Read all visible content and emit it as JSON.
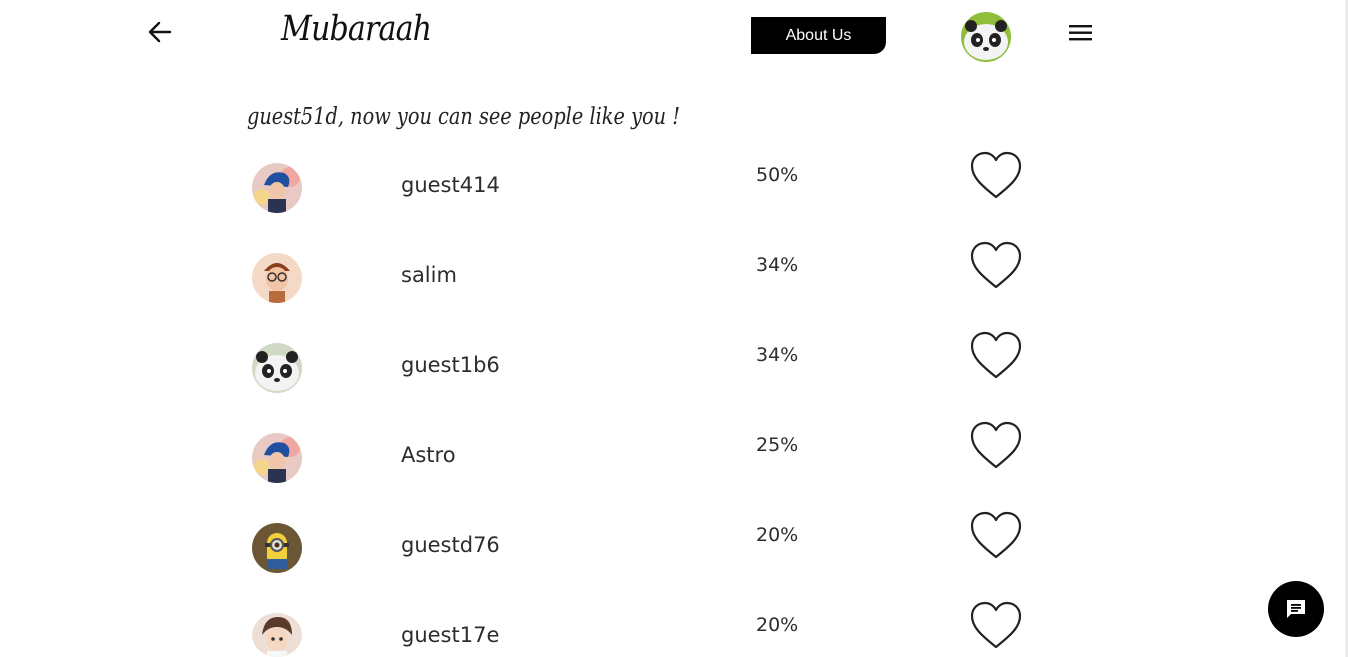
{
  "header": {
    "brand": "Mubaraah",
    "about_label": "About Us",
    "back_icon": "arrow-left-icon",
    "menu_icon": "hamburger-menu-icon"
  },
  "heading": "guest51d, now you can see people like you !",
  "matches": [
    {
      "name": "guest414",
      "percent": "50%",
      "avatar": "blue-hair-character"
    },
    {
      "name": "salim",
      "percent": "34%",
      "avatar": "cartoon-boy-glasses"
    },
    {
      "name": "guest1b6",
      "percent": "34%",
      "avatar": "panda"
    },
    {
      "name": "Astro",
      "percent": "25%",
      "avatar": "blue-hair-character"
    },
    {
      "name": "guestd76",
      "percent": "20%",
      "avatar": "minion"
    },
    {
      "name": "guest17e",
      "percent": "20%",
      "avatar": "anime-boy"
    }
  ],
  "colors": {
    "accent": "#000000",
    "background": "#ffffff",
    "text": "#2d2d2d"
  }
}
